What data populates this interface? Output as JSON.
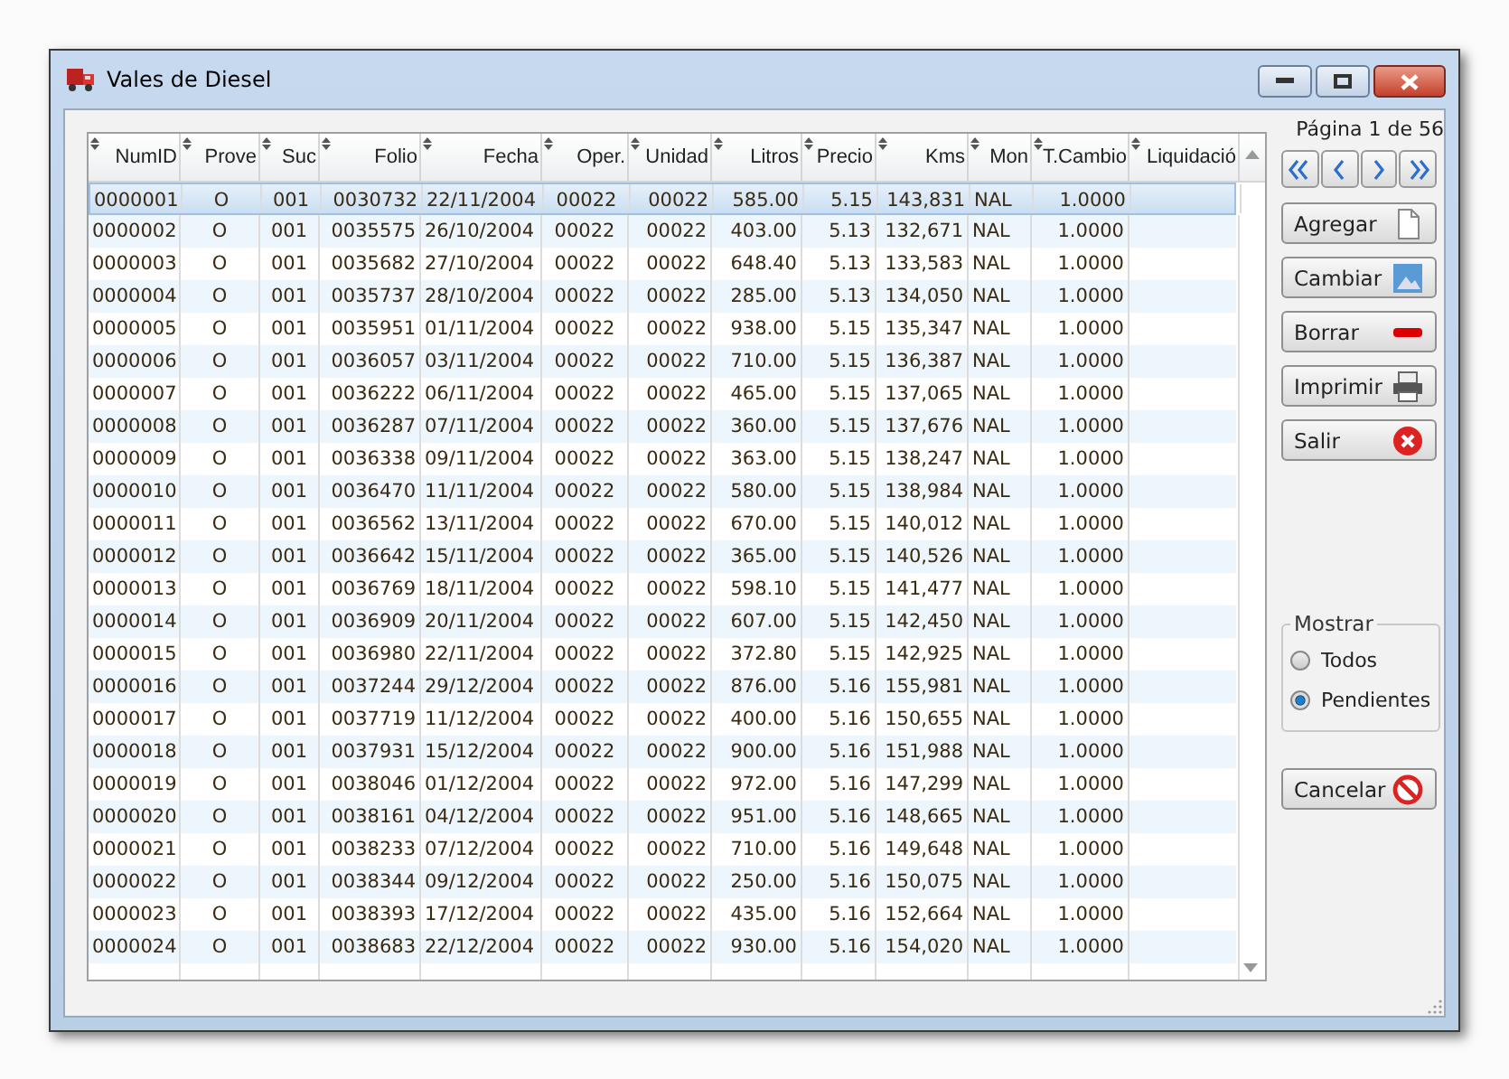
{
  "window": {
    "title": "Vales de Diesel"
  },
  "table": {
    "columns": [
      "NumID",
      "Prove",
      "Suc",
      "Folio",
      "Fecha",
      "Oper.",
      "Unidad",
      "Litros",
      "Precio",
      "Kms",
      "Mon",
      "T.Cambio",
      "Liquidació"
    ],
    "rows": [
      {
        "selected": true,
        "cells": [
          "0000001",
          "O",
          "001",
          "0030732",
          "22/11/2004",
          "00022",
          "00022",
          "585.00",
          "5.15",
          "143,831",
          "NAL",
          "1.0000"
        ]
      },
      {
        "selected": false,
        "cells": [
          "0000002",
          "O",
          "001",
          "0035575",
          "26/10/2004",
          "00022",
          "00022",
          "403.00",
          "5.13",
          "132,671",
          "NAL",
          "1.0000"
        ]
      },
      {
        "selected": false,
        "cells": [
          "0000003",
          "O",
          "001",
          "0035682",
          "27/10/2004",
          "00022",
          "00022",
          "648.40",
          "5.13",
          "133,583",
          "NAL",
          "1.0000"
        ]
      },
      {
        "selected": false,
        "cells": [
          "0000004",
          "O",
          "001",
          "0035737",
          "28/10/2004",
          "00022",
          "00022",
          "285.00",
          "5.13",
          "134,050",
          "NAL",
          "1.0000"
        ]
      },
      {
        "selected": false,
        "cells": [
          "0000005",
          "O",
          "001",
          "0035951",
          "01/11/2004",
          "00022",
          "00022",
          "938.00",
          "5.15",
          "135,347",
          "NAL",
          "1.0000"
        ]
      },
      {
        "selected": false,
        "cells": [
          "0000006",
          "O",
          "001",
          "0036057",
          "03/11/2004",
          "00022",
          "00022",
          "710.00",
          "5.15",
          "136,387",
          "NAL",
          "1.0000"
        ]
      },
      {
        "selected": false,
        "cells": [
          "0000007",
          "O",
          "001",
          "0036222",
          "06/11/2004",
          "00022",
          "00022",
          "465.00",
          "5.15",
          "137,065",
          "NAL",
          "1.0000"
        ]
      },
      {
        "selected": false,
        "cells": [
          "0000008",
          "O",
          "001",
          "0036287",
          "07/11/2004",
          "00022",
          "00022",
          "360.00",
          "5.15",
          "137,676",
          "NAL",
          "1.0000"
        ]
      },
      {
        "selected": false,
        "cells": [
          "0000009",
          "O",
          "001",
          "0036338",
          "09/11/2004",
          "00022",
          "00022",
          "363.00",
          "5.15",
          "138,247",
          "NAL",
          "1.0000"
        ]
      },
      {
        "selected": false,
        "cells": [
          "0000010",
          "O",
          "001",
          "0036470",
          "11/11/2004",
          "00022",
          "00022",
          "580.00",
          "5.15",
          "138,984",
          "NAL",
          "1.0000"
        ]
      },
      {
        "selected": false,
        "cells": [
          "0000011",
          "O",
          "001",
          "0036562",
          "13/11/2004",
          "00022",
          "00022",
          "670.00",
          "5.15",
          "140,012",
          "NAL",
          "1.0000"
        ]
      },
      {
        "selected": false,
        "cells": [
          "0000012",
          "O",
          "001",
          "0036642",
          "15/11/2004",
          "00022",
          "00022",
          "365.00",
          "5.15",
          "140,526",
          "NAL",
          "1.0000"
        ]
      },
      {
        "selected": false,
        "cells": [
          "0000013",
          "O",
          "001",
          "0036769",
          "18/11/2004",
          "00022",
          "00022",
          "598.10",
          "5.15",
          "141,477",
          "NAL",
          "1.0000"
        ]
      },
      {
        "selected": false,
        "cells": [
          "0000014",
          "O",
          "001",
          "0036909",
          "20/11/2004",
          "00022",
          "00022",
          "607.00",
          "5.15",
          "142,450",
          "NAL",
          "1.0000"
        ]
      },
      {
        "selected": false,
        "cells": [
          "0000015",
          "O",
          "001",
          "0036980",
          "22/11/2004",
          "00022",
          "00022",
          "372.80",
          "5.15",
          "142,925",
          "NAL",
          "1.0000"
        ]
      },
      {
        "selected": false,
        "cells": [
          "0000016",
          "O",
          "001",
          "0037244",
          "29/12/2004",
          "00022",
          "00022",
          "876.00",
          "5.16",
          "155,981",
          "NAL",
          "1.0000"
        ]
      },
      {
        "selected": false,
        "cells": [
          "0000017",
          "O",
          "001",
          "0037719",
          "11/12/2004",
          "00022",
          "00022",
          "400.00",
          "5.16",
          "150,655",
          "NAL",
          "1.0000"
        ]
      },
      {
        "selected": false,
        "cells": [
          "0000018",
          "O",
          "001",
          "0037931",
          "15/12/2004",
          "00022",
          "00022",
          "900.00",
          "5.16",
          "151,988",
          "NAL",
          "1.0000"
        ]
      },
      {
        "selected": false,
        "cells": [
          "0000019",
          "O",
          "001",
          "0038046",
          "01/12/2004",
          "00022",
          "00022",
          "972.00",
          "5.16",
          "147,299",
          "NAL",
          "1.0000"
        ]
      },
      {
        "selected": false,
        "cells": [
          "0000020",
          "O",
          "001",
          "0038161",
          "04/12/2004",
          "00022",
          "00022",
          "951.00",
          "5.16",
          "148,665",
          "NAL",
          "1.0000"
        ]
      },
      {
        "selected": false,
        "cells": [
          "0000021",
          "O",
          "001",
          "0038233",
          "07/12/2004",
          "00022",
          "00022",
          "710.00",
          "5.16",
          "149,648",
          "NAL",
          "1.0000"
        ]
      },
      {
        "selected": false,
        "cells": [
          "0000022",
          "O",
          "001",
          "0038344",
          "09/12/2004",
          "00022",
          "00022",
          "250.00",
          "5.16",
          "150,075",
          "NAL",
          "1.0000"
        ]
      },
      {
        "selected": false,
        "cells": [
          "0000023",
          "O",
          "001",
          "0038393",
          "17/12/2004",
          "00022",
          "00022",
          "435.00",
          "5.16",
          "152,664",
          "NAL",
          "1.0000"
        ]
      },
      {
        "selected": false,
        "cells": [
          "0000024",
          "O",
          "001",
          "0038683",
          "22/12/2004",
          "00022",
          "00022",
          "930.00",
          "5.16",
          "154,020",
          "NAL",
          "1.0000"
        ]
      }
    ]
  },
  "pager": {
    "label": "Página 1 de 56"
  },
  "actions": [
    {
      "label": "Agregar",
      "kind": "document"
    },
    {
      "label": "Cambiar",
      "kind": "picture"
    },
    {
      "label": "Borrar",
      "kind": "minus"
    },
    {
      "label": "Imprimir",
      "kind": "printer"
    },
    {
      "label": "Salir",
      "kind": "exit"
    }
  ],
  "filter": {
    "title": "Mostrar",
    "options": [
      {
        "label": "Todos",
        "selected": false
      },
      {
        "label": "Pendientes",
        "selected": true
      }
    ]
  },
  "cancel": {
    "label": "Cancelar",
    "kind": "forbidden"
  }
}
